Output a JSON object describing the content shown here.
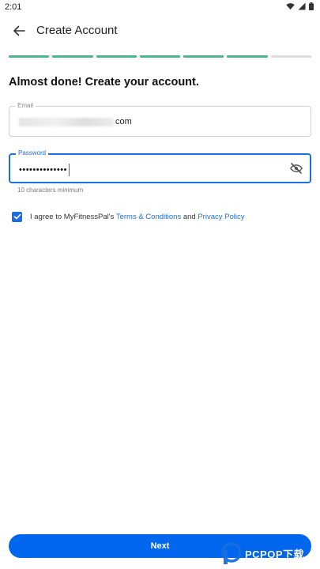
{
  "status_bar": {
    "time": "2:01"
  },
  "app_bar": {
    "title": "Create Account"
  },
  "progress": {
    "steps_total": 7,
    "steps_done": 6
  },
  "heading": "Almost done! Create your account.",
  "email": {
    "label": "Email",
    "value_suffix": "com"
  },
  "password": {
    "label": "Password",
    "value": "••••••••••••••",
    "helper": "10 characters minimum"
  },
  "agreement": {
    "checked": true,
    "prefix": "I agree to MyFitnessPal's ",
    "terms_link": "Terms & Conditions",
    "middle": " and ",
    "privacy_link": "Privacy Policy"
  },
  "next_button": {
    "label": "Next"
  },
  "watermark": {
    "text": "PCPOP下载"
  },
  "colors": {
    "accent": "#0066ee",
    "progress_done": "#4cb589",
    "progress_todo": "#dcdcdc"
  }
}
